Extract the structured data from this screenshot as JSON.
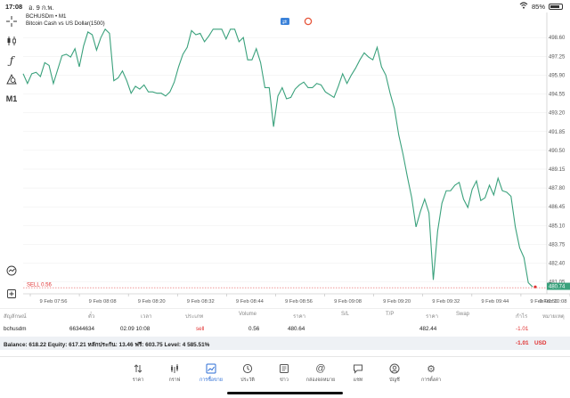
{
  "status_bar": {
    "time": "17:08",
    "date": "อ. 9 ก.พ.",
    "battery": "85%",
    "battery_level": 0.85
  },
  "left_toolbar": {
    "timeframe": "M1"
  },
  "chart_info": {
    "symbol_line": "BCHUSDm • M1",
    "description_line": "Bitcoin Cash vs US Dollar(1500)"
  },
  "colors": {
    "line": "#3aa17c",
    "sell": "#e03030",
    "accent": "#2b6cd4",
    "grid": "#ececec"
  },
  "chart_data": {
    "type": "line",
    "title": "",
    "xlabel": "",
    "ylabel": "",
    "ylim": [
      480.2,
      500.4
    ],
    "y_ticks": [
      "498.60",
      "497.25",
      "495.90",
      "494.55",
      "493.20",
      "491.85",
      "490.50",
      "489.15",
      "487.80",
      "486.45",
      "485.10",
      "483.75",
      "482.40",
      "481.05"
    ],
    "x_ticks": [
      "9 Feb 07:56",
      "9 Feb 08:08",
      "9 Feb 08:20",
      "9 Feb 08:32",
      "9 Feb 08:44",
      "9 Feb 08:56",
      "9 Feb 09:08",
      "9 Feb 09:20",
      "9 Feb 09:32",
      "9 Feb 09:44",
      "9 Feb 09:56",
      "9 Feb 10:08"
    ],
    "series": [
      {
        "values": [
          496.0,
          495.3,
          496.0,
          496.1,
          495.8,
          496.8,
          496.6,
          495.3,
          496.3,
          497.3,
          497.4,
          497.2,
          497.8,
          496.5,
          498.0,
          499.0,
          498.8,
          497.7,
          498.6,
          499.2,
          498.9,
          495.5,
          495.7,
          496.2,
          495.5,
          494.6,
          495.1,
          494.9,
          495.2,
          494.7,
          494.7,
          494.6,
          494.6,
          494.4,
          494.7,
          495.4,
          496.5,
          497.4,
          497.9,
          499.1,
          498.8,
          498.9,
          498.3,
          498.7,
          499.2,
          499.2,
          499.2,
          498.5,
          499.2,
          499.2,
          498.3,
          498.6,
          497.0,
          497.0,
          497.8,
          496.8,
          495.0,
          495.0,
          492.2,
          494.4,
          495.0,
          494.2,
          494.3,
          494.9,
          495.2,
          495.4,
          495.0,
          495.0,
          495.3,
          495.2,
          494.7,
          494.5,
          494.3,
          495.1,
          496.0,
          495.3,
          495.9,
          496.4,
          497.0,
          497.5,
          497.2,
          497.0,
          497.9,
          496.5,
          495.9,
          494.6,
          493.5,
          491.6,
          490.2,
          488.6,
          487.1,
          485.0,
          486.1,
          487.0,
          486.0,
          481.2,
          484.7,
          486.7,
          487.6,
          487.6,
          488.0,
          488.2,
          487.0,
          486.4,
          487.7,
          488.3,
          486.9,
          487.1,
          488.0,
          487.3,
          488.5,
          487.6,
          487.5,
          487.2,
          485.0,
          483.5,
          482.8,
          481.0,
          480.7
        ]
      }
    ],
    "current_price_label": "480.74",
    "position_line_label": "SELL 0.56",
    "position_price": 480.64
  },
  "positions_table": {
    "headers": [
      "สัญลักษณ์",
      "ตั๋ว",
      "เวลา",
      "ประเภท",
      "Volume",
      "ราคา",
      "S/L",
      "T/P",
      "ราคา",
      "Swap",
      "กำไร",
      "หมายเหตุ"
    ],
    "rows": [
      [
        "bchusdm",
        "66344634",
        "02.09 10:08",
        "sell",
        "0.56",
        "480.64",
        "",
        "",
        "482.44",
        "",
        "-1.01",
        ""
      ]
    ]
  },
  "balance_row": {
    "text": "Balance: 618.22 Equity: 617.21 หลักประกัน: 13.46 ฟรี: 603.75 Level: 4 585.51%",
    "profit": "-1.01",
    "currency": "USD"
  },
  "bottom_nav": [
    {
      "label": "ราคา",
      "icon": "arrows-updown-icon"
    },
    {
      "label": "กราฟ",
      "icon": "bar-chart-icon"
    },
    {
      "label": "การซื้อขาย",
      "icon": "trade-chart-icon"
    },
    {
      "label": "ประวัติ",
      "icon": "history-icon"
    },
    {
      "label": "ข่าว",
      "icon": "news-icon"
    },
    {
      "label": "กล่องจดหมาย",
      "icon": "at-icon"
    },
    {
      "label": "แชท",
      "icon": "chat-icon"
    },
    {
      "label": "บัญชี",
      "icon": "account-icon"
    },
    {
      "label": "การตั้งค่า",
      "icon": "settings-icon"
    }
  ]
}
